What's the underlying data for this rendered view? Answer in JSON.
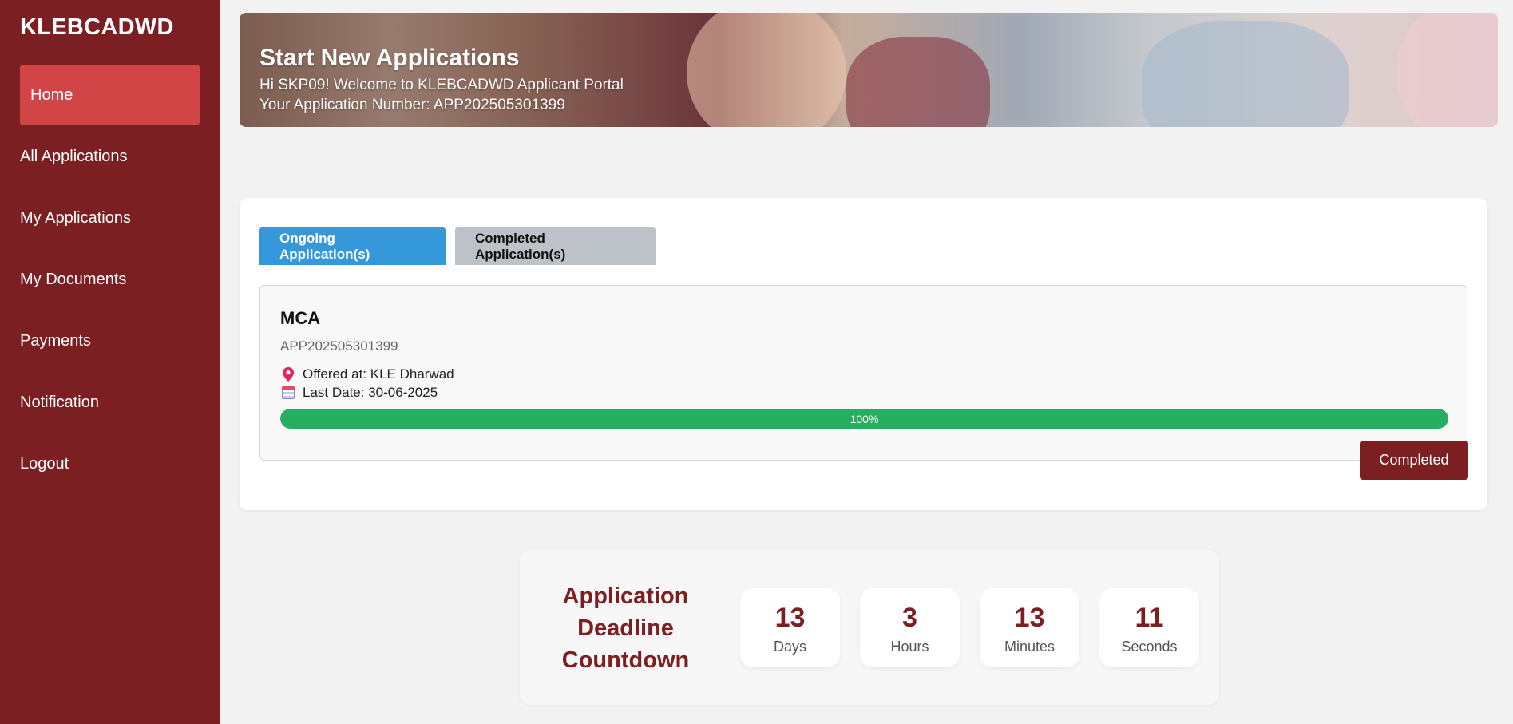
{
  "sidebar": {
    "brand": "KLEBCADWD",
    "items": [
      {
        "label": "Home",
        "active": true
      },
      {
        "label": "All Applications"
      },
      {
        "label": "My Applications"
      },
      {
        "label": "My Documents"
      },
      {
        "label": "Payments"
      },
      {
        "label": "Notification"
      },
      {
        "label": "Logout"
      }
    ]
  },
  "banner": {
    "title": "Start New Applications",
    "greeting": "Hi SKP09! Welcome to KLEBCADWD Applicant Portal",
    "application_number_line": "Your Application Number: APP202505301399"
  },
  "tabs": [
    {
      "label": "Ongoing Application(s)",
      "active": true
    },
    {
      "label": "Completed Application(s)",
      "active": false
    }
  ],
  "application": {
    "name": "MCA",
    "number": "APP202505301399",
    "offered_at": "Offered at: KLE Dharwad",
    "last_date": "Last Date: 30-06-2025",
    "progress": 100,
    "progress_label": "100%",
    "status_label": "Completed",
    "icons": {
      "location": "pin-icon",
      "date": "calendar-icon"
    }
  },
  "countdown": {
    "title_lines": [
      "Application",
      "Deadline",
      "Countdown"
    ],
    "units": [
      {
        "value": "13",
        "label": "Days"
      },
      {
        "value": "3",
        "label": "Hours"
      },
      {
        "value": "13",
        "label": "Minutes"
      },
      {
        "value": "11",
        "label": "Seconds"
      }
    ]
  },
  "colors": {
    "sidebar": "#7b1f22",
    "active_nav": "#d14547",
    "active_tab": "#3498db",
    "inactive_tab": "#bcc2c7",
    "progress": "#27ae60",
    "accent": "#7b1f22"
  }
}
